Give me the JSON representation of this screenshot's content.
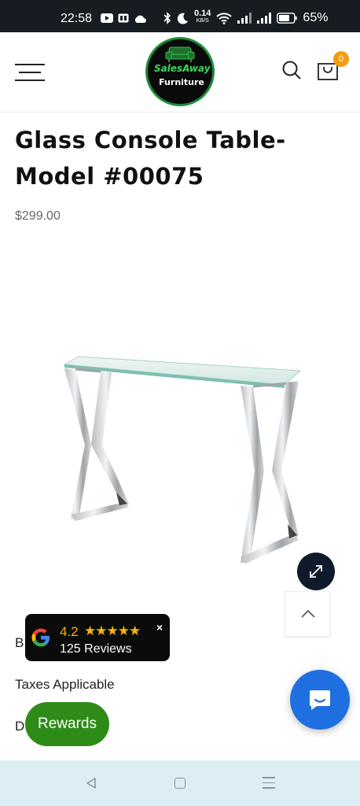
{
  "status_bar": {
    "time": "22:58",
    "net_speed_value": "0.14",
    "net_speed_unit": "KB/S",
    "battery": "65%"
  },
  "header": {
    "logo_line1": "SalesAway",
    "logo_line2": "Furniture",
    "cart_count": "0"
  },
  "product": {
    "title": "Glass Console Table- Model #00075",
    "price": "$299.00"
  },
  "details": {
    "line1_visible": "B",
    "taxes": "Taxes Applicable",
    "line3_visible": "D"
  },
  "reviews_widget": {
    "rating": "4.2",
    "stars": "★★★★★",
    "count": "125 Reviews",
    "close": "×"
  },
  "rewards": {
    "label": "Rewards"
  },
  "colors": {
    "status_bar_bg": "#161c22",
    "logo_ring": "#1c8e3a",
    "cart_badge": "#f39c12",
    "chat_button": "#1f6fe0",
    "rewards_button": "#2e8b18",
    "star": "#f5b50a",
    "nav_bar_bg": "#dceef3"
  }
}
